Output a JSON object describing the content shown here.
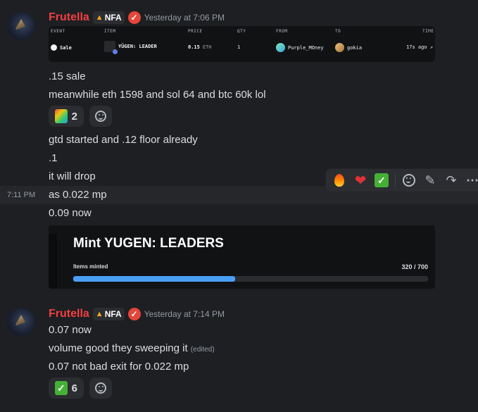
{
  "message1": {
    "username": "Frutella",
    "tag": "NFA",
    "verified_mark": "✓",
    "timestamp": "Yesterday at 7:06 PM"
  },
  "sale_table": {
    "headers": [
      "EVENT",
      "ITEM",
      "PRICE",
      "QTY",
      "FROM",
      "TO",
      "TIME"
    ],
    "row": {
      "event": "Sale",
      "item": "YÜGEN: LEADER",
      "price": "0.15",
      "currency": "ETH",
      "qty": "1",
      "from": "Purple_MOney",
      "to": "gokia",
      "time": "17s ago ↗"
    }
  },
  "messages_block1": [
    ".15 sale",
    "meanwhile eth 1598 and sol 64 and btc 60k lol"
  ],
  "reaction1": {
    "emoji": "party-emoji-icon",
    "count": "2"
  },
  "messages_block2": [
    "gtd started and .12 floor already",
    ".1",
    "it will drop"
  ],
  "hovered_message": {
    "time": "7:11 PM",
    "text": "as 0.022 mp"
  },
  "message_after": "0.09 now",
  "toolbar": {
    "quick_reactions": [
      "fire-icon",
      "heart-icon",
      "check-icon"
    ],
    "actions": [
      "add-reaction-icon",
      "edit-icon",
      "forward-icon",
      "more-icon"
    ]
  },
  "mint_embed": {
    "title": "Mint YUGEN: LEADERS",
    "progress_label": "Items minted",
    "progress_text": "320 / 700",
    "minted": 320,
    "total": 700,
    "accent": "#4a9ff5"
  },
  "message2": {
    "username": "Frutella",
    "tag": "NFA",
    "verified_mark": "✓",
    "timestamp": "Yesterday at 7:14 PM",
    "lines": [
      "0.07 now",
      "volume good they sweeping it",
      "0.07 not bad exit for 0.022 mp"
    ],
    "edited_label": "(edited)"
  },
  "reaction2": {
    "emoji": "check-icon",
    "count": "6"
  },
  "colors": {
    "background": "#1e1f22",
    "username": "#f23f42",
    "verified": "#e5453a",
    "reaction_bg": "#2b2d31",
    "check_green": "#44b035"
  }
}
